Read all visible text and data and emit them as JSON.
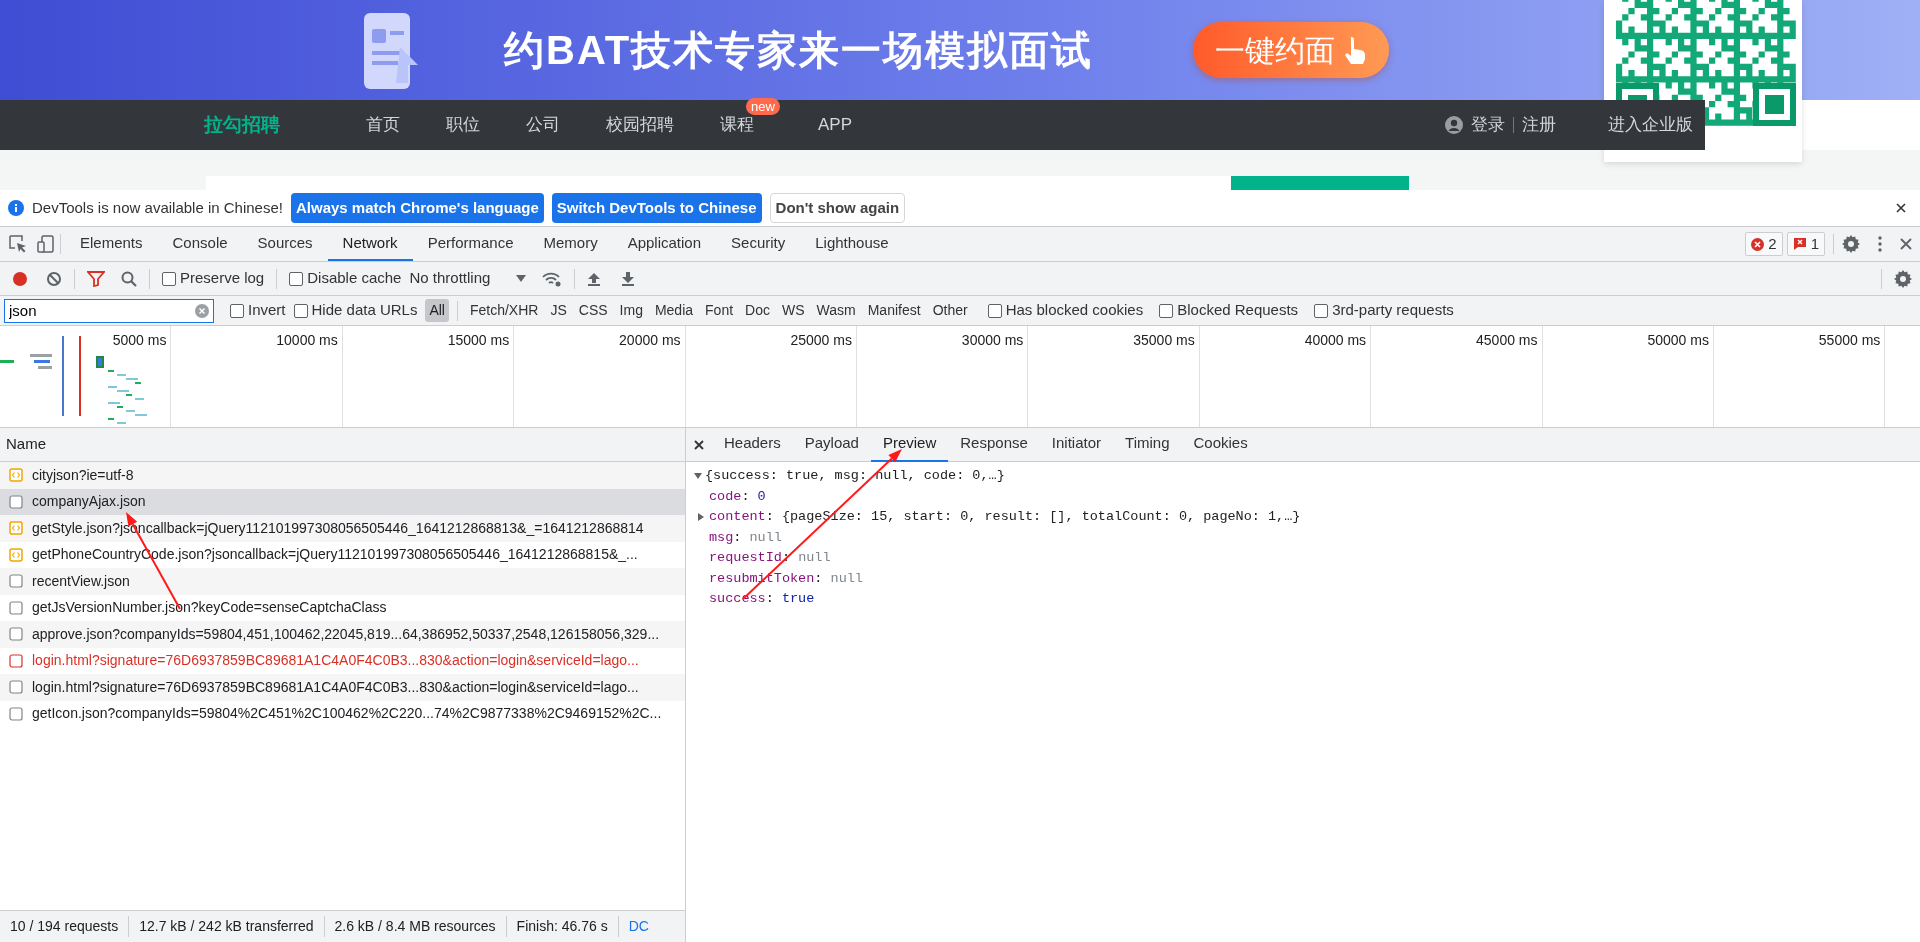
{
  "banner": {
    "headline": "约BAT技术专家来一场模拟面试",
    "cta_button": "一键约面"
  },
  "site_nav": {
    "logo": "拉勾招聘",
    "items": [
      {
        "label": "首页"
      },
      {
        "label": "职位"
      },
      {
        "label": "公司"
      },
      {
        "label": "校园招聘"
      },
      {
        "label": "课程",
        "badge": "new"
      },
      {
        "label": "APP"
      }
    ],
    "login": "登录",
    "register": "注册",
    "enterprise": "进入企业版"
  },
  "infobar": {
    "message": "DevTools is now available in Chinese!",
    "buttons": [
      {
        "label": "Always match Chrome's language",
        "kind": "primary"
      },
      {
        "label": "Switch DevTools to Chinese",
        "kind": "primary"
      },
      {
        "label": "Don't show again",
        "kind": "secondary"
      }
    ]
  },
  "devtools_tabs": [
    {
      "label": "Elements",
      "selected": false
    },
    {
      "label": "Console",
      "selected": false
    },
    {
      "label": "Sources",
      "selected": false
    },
    {
      "label": "Network",
      "selected": true
    },
    {
      "label": "Performance",
      "selected": false
    },
    {
      "label": "Memory",
      "selected": false
    },
    {
      "label": "Application",
      "selected": false
    },
    {
      "label": "Security",
      "selected": false
    },
    {
      "label": "Lighthouse",
      "selected": false
    }
  ],
  "counters": {
    "errors": "2",
    "issues": "1"
  },
  "toolbar": {
    "recording": true,
    "filter_active": true,
    "preserve_log": {
      "label": "Preserve log",
      "checked": false
    },
    "disable_cache": {
      "label": "Disable cache",
      "checked": false
    },
    "throttling": "No throttling"
  },
  "filter_bar": {
    "value": "json",
    "invert": {
      "label": "Invert",
      "checked": false
    },
    "hide_data_urls": {
      "label": "Hide data URLs",
      "checked": false
    },
    "types": [
      {
        "label": "All",
        "selected": true
      },
      {
        "label": "Fetch/XHR",
        "selected": false
      },
      {
        "label": "JS",
        "selected": false
      },
      {
        "label": "CSS",
        "selected": false
      },
      {
        "label": "Img",
        "selected": false
      },
      {
        "label": "Media",
        "selected": false
      },
      {
        "label": "Font",
        "selected": false
      },
      {
        "label": "Doc",
        "selected": false
      },
      {
        "label": "WS",
        "selected": false
      },
      {
        "label": "Wasm",
        "selected": false
      },
      {
        "label": "Manifest",
        "selected": false
      },
      {
        "label": "Other",
        "selected": false
      }
    ],
    "options": [
      {
        "label": "Has blocked cookies",
        "checked": false
      },
      {
        "label": "Blocked Requests",
        "checked": false
      },
      {
        "label": "3rd-party requests",
        "checked": false
      }
    ]
  },
  "timeline": {
    "ticks": [
      "5000 ms",
      "10000 ms",
      "15000 ms",
      "20000 ms",
      "25000 ms",
      "30000 ms",
      "35000 ms",
      "40000 ms",
      "45000 ms",
      "50000 ms",
      "55000 ms"
    ]
  },
  "requests": {
    "column": "Name",
    "rows": [
      {
        "name": "cityjson?ie=utf-8",
        "kind": "script",
        "selected": false,
        "failed": false
      },
      {
        "name": "companyAjax.json",
        "kind": "doc",
        "selected": true,
        "failed": false
      },
      {
        "name": "getStyle.json?jsoncallback=jQuery112101997308056505446_1641212868813&_=1641212868814",
        "kind": "script",
        "selected": false,
        "failed": false
      },
      {
        "name": "getPhoneCountryCode.json?jsoncallback=jQuery112101997308056505446_1641212868815&_...",
        "kind": "script",
        "selected": false,
        "failed": false
      },
      {
        "name": "recentView.json",
        "kind": "doc",
        "selected": false,
        "failed": false
      },
      {
        "name": "getJsVersionNumber.json?keyCode=senseCaptchaClass",
        "kind": "doc",
        "selected": false,
        "failed": false
      },
      {
        "name": "approve.json?companyIds=59804,451,100462,22045,819...64,386952,50337,2548,126158056,329...",
        "kind": "doc",
        "selected": false,
        "failed": false
      },
      {
        "name": "login.html?signature=76D6937859BC89681A1C4A0F4C0B3...830&action=login&serviceId=lago...",
        "kind": "doc",
        "selected": false,
        "failed": true
      },
      {
        "name": "login.html?signature=76D6937859BC89681A1C4A0F4C0B3...830&action=login&serviceId=lago...",
        "kind": "doc",
        "selected": false,
        "failed": false
      },
      {
        "name": "getIcon.json?companyIds=59804%2C451%2C100462%2C220...74%2C9877338%2C9469152%2C...",
        "kind": "doc",
        "selected": false,
        "failed": false
      }
    ]
  },
  "detail_tabs": [
    {
      "label": "Headers",
      "selected": false
    },
    {
      "label": "Payload",
      "selected": false
    },
    {
      "label": "Preview",
      "selected": true
    },
    {
      "label": "Response",
      "selected": false
    },
    {
      "label": "Initiator",
      "selected": false
    },
    {
      "label": "Timing",
      "selected": false
    },
    {
      "label": "Cookies",
      "selected": false
    }
  ],
  "preview": {
    "summary": "{success: true, msg: null, code: 0,…}",
    "expanded": true,
    "delimiter": ":",
    "children": [
      {
        "key": "code",
        "value": "0",
        "kind": "number"
      },
      {
        "key": "content",
        "value": "{pageSize: 15, start: 0, result: [], totalCount: 0, pageNo: 1,…}",
        "kind": "object",
        "expanded": false
      },
      {
        "key": "msg",
        "value": "null",
        "kind": "null"
      },
      {
        "key": "requestId",
        "value": "null",
        "kind": "null"
      },
      {
        "key": "resubmitToken",
        "value": "null",
        "kind": "null"
      },
      {
        "key": "success",
        "value": "true",
        "kind": "boolean"
      }
    ]
  },
  "status_bar": [
    {
      "text": "10 / 194 requests",
      "kind": "text"
    },
    {
      "text": "12.7 kB / 242 kB transferred",
      "kind": "text"
    },
    {
      "text": "2.6 kB / 8.4 MB resources",
      "kind": "text"
    },
    {
      "text": "Finish: 46.76 s",
      "kind": "text"
    },
    {
      "text": "DC",
      "kind": "link"
    }
  ]
}
